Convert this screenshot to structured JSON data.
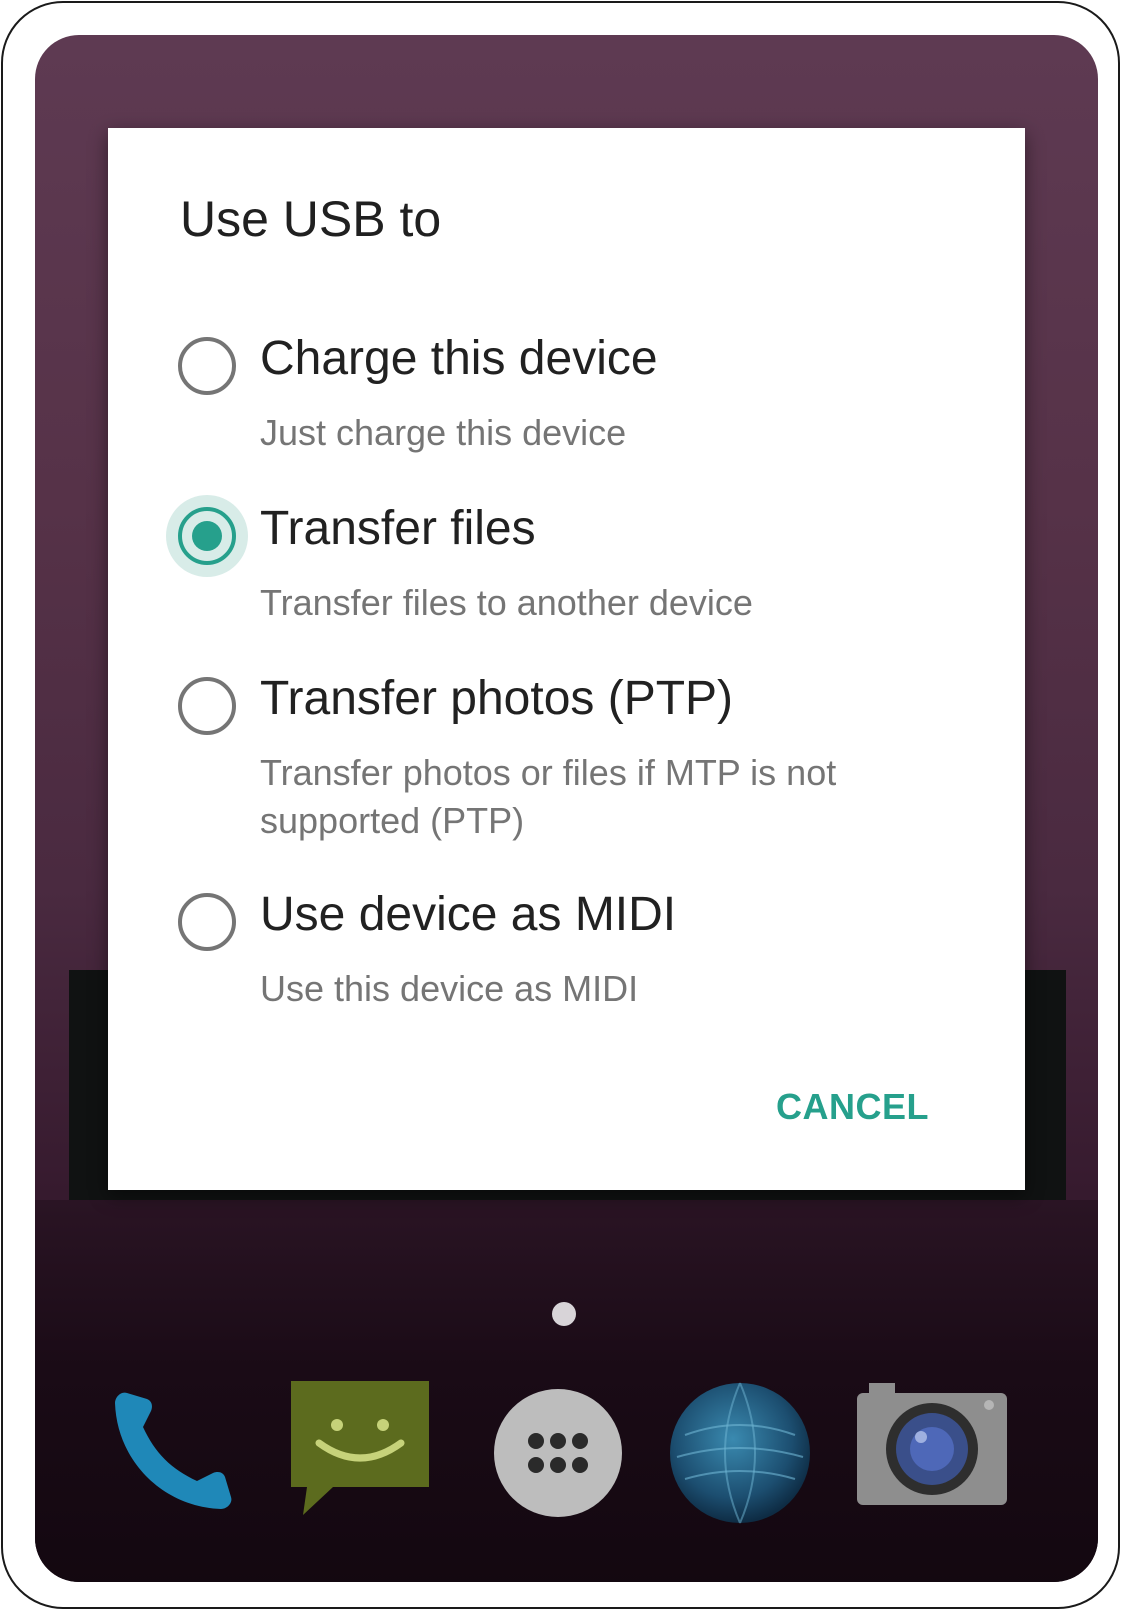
{
  "dialog": {
    "title": "Use USB to",
    "options": [
      {
        "label": "Charge this device",
        "description": "Just charge this device",
        "selected": false
      },
      {
        "label": "Transfer files",
        "description": "Transfer files to another device",
        "selected": true
      },
      {
        "label": "Transfer photos (PTP)",
        "description": "Transfer photos or files if MTP is not supported (PTP)",
        "selected": false
      },
      {
        "label": "Use device as MIDI",
        "description": "Use this device as MIDI",
        "selected": false
      }
    ],
    "cancel_label": "CANCEL"
  },
  "dock": {
    "icons": [
      "phone-icon",
      "messaging-icon",
      "app-drawer-icon",
      "browser-icon",
      "camera-icon"
    ]
  },
  "colors": {
    "accent": "#26a08c",
    "text_primary": "#212121",
    "text_secondary": "#757575"
  }
}
